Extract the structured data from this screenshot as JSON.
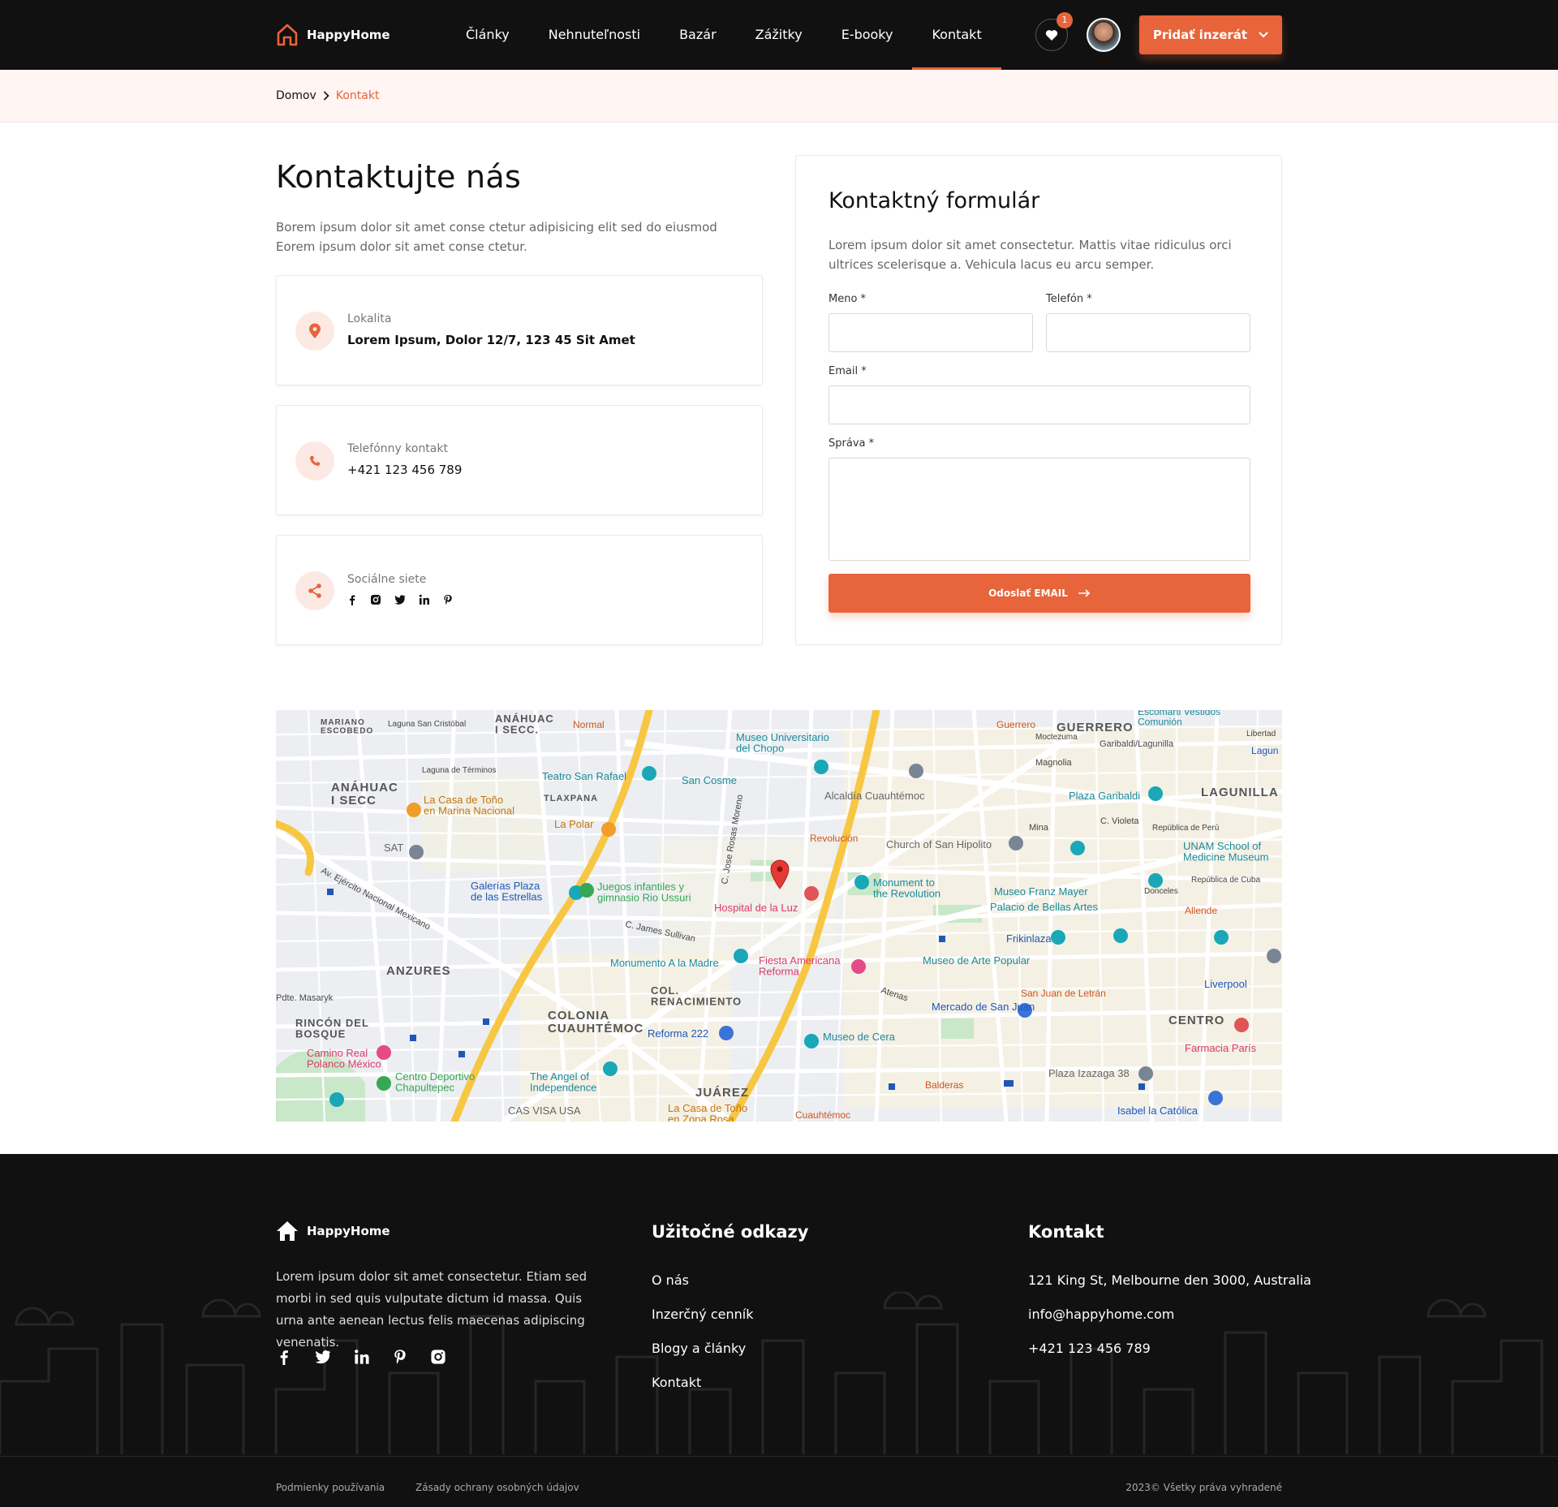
{
  "header": {
    "brand": "HappyHome",
    "nav": [
      "Články",
      "Nehnuteľnosti",
      "Bazár",
      "Zážitky",
      "E-booky",
      "Kontakt"
    ],
    "active_nav": "Kontakt",
    "favorites_count": "1",
    "add_button": "Pridať inzerát",
    "accent": "#e8643a"
  },
  "breadcrumb": {
    "home": "Domov",
    "current": "Kontakt"
  },
  "contact": {
    "title": "Kontaktujte nás",
    "intro": "Borem ipsum dolor sit amet conse ctetur adipisicing elit sed do eiusmod Eorem ipsum dolor sit amet conse ctetur.",
    "location": {
      "label": "Lokalita",
      "value": "Lorem Ipsum, Dolor 12/7, 123 45 Sit Amet",
      "icon": "map-pin-icon"
    },
    "phone": {
      "label": "Telefónny kontakt",
      "value": "+421 123 456 789",
      "icon": "phone-icon"
    },
    "social": {
      "label": "Sociálne siete",
      "icon": "share-icon",
      "networks": [
        "facebook",
        "instagram",
        "twitter",
        "linkedin",
        "pinterest"
      ]
    }
  },
  "form": {
    "title": "Kontaktný formulár",
    "description": "Lorem ipsum dolor sit amet consectetur. Mattis vitae ridiculus orci ultrices scelerisque a. Vehicula lacus eu arcu semper.",
    "name_label": "Meno *",
    "phone_label": "Telefón *",
    "email_label": "Email *",
    "message_label": "Správa *",
    "submit": "Odoslať EMAIL"
  },
  "map": {
    "labels": {
      "anahuac_i_secc": "ANÁHUAC\nI SECC.",
      "anahuac": "ANÁHUAC\nI SECC",
      "guerrero": "GUERRERO",
      "lagunilla": "LAGUNILLA",
      "anzures": "ANZURES",
      "rincon": "RINCÓN DEL\nBOSQUE",
      "colonia": "COLONIA\nCUAUHTÉMOC",
      "renacimiento": "COL.\nRENACIMIENTO",
      "juarez": "JUÁREZ",
      "centro": "CENTRO",
      "museo_univ": "Museo Universitario\ndel Chopo",
      "teatro": "Teatro San Rafael",
      "san_cosme": "San Cosme",
      "alcaldia": "Alcaldía Cuauhtémoc",
      "plaza_garibaldi": "Plaza Garibaldi",
      "la_casa_tono": "La Casa de Toño\nen Marina Nacional",
      "la_polar": "La Polar",
      "revolucion": "Revolución",
      "church": "Church of San Hipolito",
      "unam": "UNAM School of\nMedicine Museum",
      "sat": "SAT",
      "galerias": "Galerías Plaza\nde las Estrellas",
      "juegos": "Juegos infantiles y\ngimnasio Rio Ussuri",
      "hospital": "Hospital de la Luz",
      "monument": "Monument to\nthe Revolution",
      "franz_mayer": "Museo Franz Mayer",
      "bellas_artes": "Palacio de Bellas Artes",
      "allende": "Allende",
      "frikinlaza": "Frikinlaza",
      "monumento_madre": "Monumento A la Madre",
      "fiesta": "Fiesta Americana\nReforma",
      "arte_popular": "Museo de Arte Popular",
      "san_juan_letran": "San Juan de Letrán",
      "liverpool": "Liverpool",
      "mercado": "Mercado de San Juan",
      "reforma222": "Reforma 222",
      "museo_cera": "Museo de Cera",
      "farmacia": "Farmacia París",
      "angel": "The Angel of\nIndependence",
      "camino_real": "Camino Real\nPolanco México",
      "centro_dep": "Centro Deportivo\nChapultepec",
      "la_casa_zona": "La Casa de Toño\nen Zona Rosa",
      "cas_visa": "CAS VISA USA",
      "balderas": "Balderas",
      "plaza_izazaga": "Plaza Izazaga 38",
      "isabel": "Isabel la Católica",
      "cuauhtemoc": "Cuauhtémoc",
      "normal": "Normal",
      "mariano": "MARIANO\nESCOBEDO",
      "tlaxpana": "TLAXPANA",
      "av_ejercito": "Av. Ejército Nacional Mexicano",
      "james_sullivan": "C. James Sullivan",
      "mina": "Mina",
      "magnolia": "Magnolia",
      "violeta": "C. Violeta",
      "republica_peru": "República de Perú",
      "republica_cuba": "República de Cuba",
      "donceles": "Donceles",
      "atenas": "Atenas",
      "pdte_masaryk": "Pdte. Masaryk",
      "laguna_terminos": "Laguna de Términos",
      "laguna_cristobal": "Laguna San Cristóbal",
      "jose_rosas": "C. Jose Rosas Moreno",
      "guerrero_metro": "Guerrero",
      "escomarti": "Escomarti Vestidos\nComunión",
      "garibaldi_lagunilla": "Garibaldi/Lagunilla",
      "moctezuma": "Moctezuma",
      "libertad": "Libertad",
      "laguna": "Lagun"
    }
  },
  "footer": {
    "brand": "HappyHome",
    "description": "Lorem ipsum dolor sit amet consectetur. Etiam sed morbi in sed quis vulputate dictum id massa. Quis urna ante aenean lectus felis maecenas adipiscing venenatis.",
    "links_title": "Užitočné odkazy",
    "links": [
      "O nás",
      "Inzerčný cenník",
      "Blogy a články",
      "Kontakt"
    ],
    "contact_title": "Kontakt",
    "address": "121 King St, Melbourne den 3000, Australia",
    "email": "info@happyhome.com",
    "phone": "+421 123 456 789",
    "terms": "Podmienky používania",
    "privacy": "Zásady ochrany osobných údajov",
    "copyright": "2023© Všetky práva vyhradené"
  }
}
